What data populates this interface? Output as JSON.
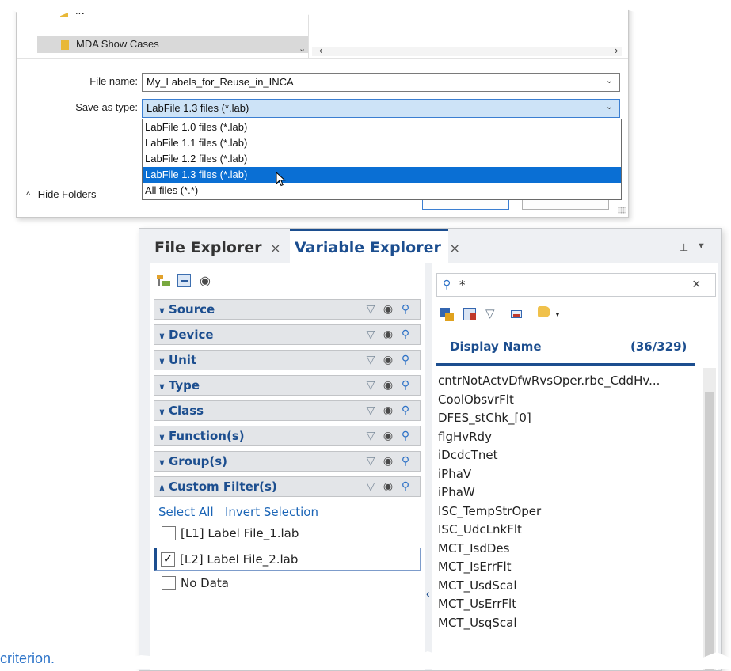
{
  "save_dialog": {
    "tree": {
      "partial_item": "..tel",
      "selected_folder": "MDA Show Cases"
    },
    "file_name": {
      "label": "File name:",
      "value": "My_Labels_for_Reuse_in_INCA"
    },
    "save_as_type": {
      "label": "Save as type:",
      "value": "LabFile 1.3 files (*.lab)",
      "options": [
        "LabFile 1.0 files (*.lab)",
        "LabFile 1.1 files (*.lab)",
        "LabFile 1.2 files (*.lab)",
        "LabFile 1.3 files (*.lab)",
        "All files (*.*)"
      ],
      "highlighted_index": 3
    },
    "hide_folders": "Hide Folders"
  },
  "explorer": {
    "tabs": [
      {
        "label": "File Explorer",
        "active": false
      },
      {
        "label": "Variable Explorer",
        "active": true
      }
    ],
    "sections": [
      {
        "label": "Source",
        "expanded": false
      },
      {
        "label": "Device",
        "expanded": false
      },
      {
        "label": "Unit",
        "expanded": false
      },
      {
        "label": "Type",
        "expanded": false
      },
      {
        "label": "Class",
        "expanded": false
      },
      {
        "label": "Function(s)",
        "expanded": false
      },
      {
        "label": "Group(s)",
        "expanded": false
      },
      {
        "label": "Custom Filter(s)",
        "expanded": true
      }
    ],
    "custom_filter": {
      "select_all": "Select All",
      "invert_selection": "Invert Selection",
      "items": [
        {
          "label": "[L1] Label File_1.lab",
          "checked": false
        },
        {
          "label": "[L2] Label File_2.lab",
          "checked": true
        },
        {
          "label": "No Data",
          "checked": false
        }
      ]
    },
    "search": {
      "value": "*"
    },
    "list": {
      "header": "Display Name",
      "count": "(36/329)",
      "items": [
        "cntrNotActvDfwRvsOper.rbe_CddHv...",
        "CoolObsvrFlt",
        "DFES_stChk_[0]",
        "flgHvRdy",
        "iDcdcTnet",
        "iPhaV",
        "iPhaW",
        "ISC_TempStrOper",
        "ISC_UdcLnkFlt",
        "MCT_IsdDes",
        "MCT_IsErrFlt",
        "MCT_UsdScal",
        "MCT_UsErrFlt",
        "MCT_UsqScal"
      ]
    }
  },
  "caption_fragment": "criterion.",
  "colors": {
    "accent": "#1c4e8f",
    "selection": "#0a6fd4",
    "link": "#1a64b6"
  }
}
